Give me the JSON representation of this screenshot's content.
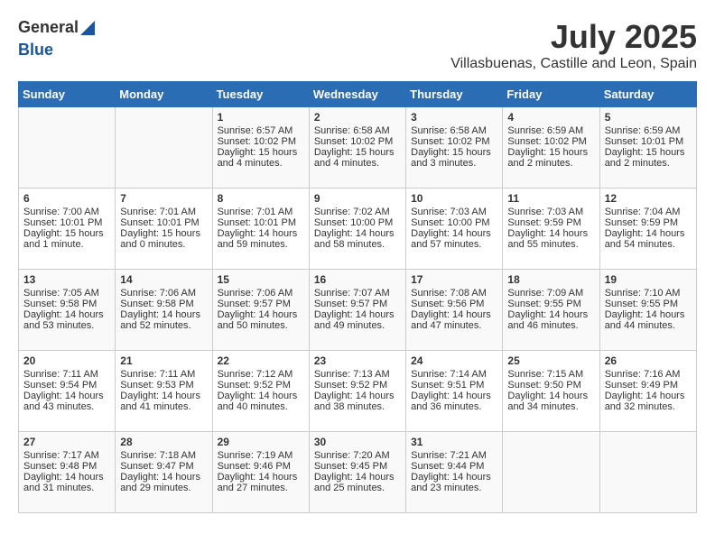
{
  "header": {
    "logo_general": "General",
    "logo_blue": "Blue",
    "month": "July 2025",
    "location": "Villasbuenas, Castille and Leon, Spain"
  },
  "weekdays": [
    "Sunday",
    "Monday",
    "Tuesday",
    "Wednesday",
    "Thursday",
    "Friday",
    "Saturday"
  ],
  "weeks": [
    [
      {
        "day": "",
        "text": ""
      },
      {
        "day": "",
        "text": ""
      },
      {
        "day": "1",
        "text": "Sunrise: 6:57 AM\nSunset: 10:02 PM\nDaylight: 15 hours\nand 4 minutes."
      },
      {
        "day": "2",
        "text": "Sunrise: 6:58 AM\nSunset: 10:02 PM\nDaylight: 15 hours\nand 4 minutes."
      },
      {
        "day": "3",
        "text": "Sunrise: 6:58 AM\nSunset: 10:02 PM\nDaylight: 15 hours\nand 3 minutes."
      },
      {
        "day": "4",
        "text": "Sunrise: 6:59 AM\nSunset: 10:02 PM\nDaylight: 15 hours\nand 2 minutes."
      },
      {
        "day": "5",
        "text": "Sunrise: 6:59 AM\nSunset: 10:01 PM\nDaylight: 15 hours\nand 2 minutes."
      }
    ],
    [
      {
        "day": "6",
        "text": "Sunrise: 7:00 AM\nSunset: 10:01 PM\nDaylight: 15 hours\nand 1 minute."
      },
      {
        "day": "7",
        "text": "Sunrise: 7:01 AM\nSunset: 10:01 PM\nDaylight: 15 hours\nand 0 minutes."
      },
      {
        "day": "8",
        "text": "Sunrise: 7:01 AM\nSunset: 10:01 PM\nDaylight: 14 hours\nand 59 minutes."
      },
      {
        "day": "9",
        "text": "Sunrise: 7:02 AM\nSunset: 10:00 PM\nDaylight: 14 hours\nand 58 minutes."
      },
      {
        "day": "10",
        "text": "Sunrise: 7:03 AM\nSunset: 10:00 PM\nDaylight: 14 hours\nand 57 minutes."
      },
      {
        "day": "11",
        "text": "Sunrise: 7:03 AM\nSunset: 9:59 PM\nDaylight: 14 hours\nand 55 minutes."
      },
      {
        "day": "12",
        "text": "Sunrise: 7:04 AM\nSunset: 9:59 PM\nDaylight: 14 hours\nand 54 minutes."
      }
    ],
    [
      {
        "day": "13",
        "text": "Sunrise: 7:05 AM\nSunset: 9:58 PM\nDaylight: 14 hours\nand 53 minutes."
      },
      {
        "day": "14",
        "text": "Sunrise: 7:06 AM\nSunset: 9:58 PM\nDaylight: 14 hours\nand 52 minutes."
      },
      {
        "day": "15",
        "text": "Sunrise: 7:06 AM\nSunset: 9:57 PM\nDaylight: 14 hours\nand 50 minutes."
      },
      {
        "day": "16",
        "text": "Sunrise: 7:07 AM\nSunset: 9:57 PM\nDaylight: 14 hours\nand 49 minutes."
      },
      {
        "day": "17",
        "text": "Sunrise: 7:08 AM\nSunset: 9:56 PM\nDaylight: 14 hours\nand 47 minutes."
      },
      {
        "day": "18",
        "text": "Sunrise: 7:09 AM\nSunset: 9:55 PM\nDaylight: 14 hours\nand 46 minutes."
      },
      {
        "day": "19",
        "text": "Sunrise: 7:10 AM\nSunset: 9:55 PM\nDaylight: 14 hours\nand 44 minutes."
      }
    ],
    [
      {
        "day": "20",
        "text": "Sunrise: 7:11 AM\nSunset: 9:54 PM\nDaylight: 14 hours\nand 43 minutes."
      },
      {
        "day": "21",
        "text": "Sunrise: 7:11 AM\nSunset: 9:53 PM\nDaylight: 14 hours\nand 41 minutes."
      },
      {
        "day": "22",
        "text": "Sunrise: 7:12 AM\nSunset: 9:52 PM\nDaylight: 14 hours\nand 40 minutes."
      },
      {
        "day": "23",
        "text": "Sunrise: 7:13 AM\nSunset: 9:52 PM\nDaylight: 14 hours\nand 38 minutes."
      },
      {
        "day": "24",
        "text": "Sunrise: 7:14 AM\nSunset: 9:51 PM\nDaylight: 14 hours\nand 36 minutes."
      },
      {
        "day": "25",
        "text": "Sunrise: 7:15 AM\nSunset: 9:50 PM\nDaylight: 14 hours\nand 34 minutes."
      },
      {
        "day": "26",
        "text": "Sunrise: 7:16 AM\nSunset: 9:49 PM\nDaylight: 14 hours\nand 32 minutes."
      }
    ],
    [
      {
        "day": "27",
        "text": "Sunrise: 7:17 AM\nSunset: 9:48 PM\nDaylight: 14 hours\nand 31 minutes."
      },
      {
        "day": "28",
        "text": "Sunrise: 7:18 AM\nSunset: 9:47 PM\nDaylight: 14 hours\nand 29 minutes."
      },
      {
        "day": "29",
        "text": "Sunrise: 7:19 AM\nSunset: 9:46 PM\nDaylight: 14 hours\nand 27 minutes."
      },
      {
        "day": "30",
        "text": "Sunrise: 7:20 AM\nSunset: 9:45 PM\nDaylight: 14 hours\nand 25 minutes."
      },
      {
        "day": "31",
        "text": "Sunrise: 7:21 AM\nSunset: 9:44 PM\nDaylight: 14 hours\nand 23 minutes."
      },
      {
        "day": "",
        "text": ""
      },
      {
        "day": "",
        "text": ""
      }
    ]
  ]
}
